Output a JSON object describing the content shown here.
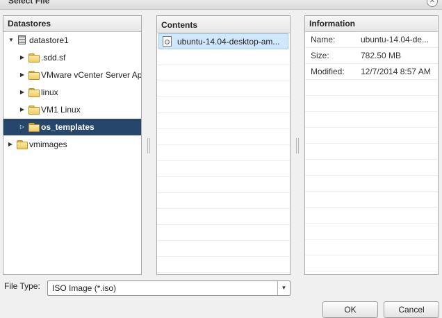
{
  "dialog": {
    "title": "Select File",
    "close_glyph": "✕"
  },
  "datastores": {
    "header": "Datastores",
    "items": [
      {
        "label": "datastore1",
        "expanded": true
      },
      {
        "label": ".sdd.sf"
      },
      {
        "label": "VMware vCenter Server Ap"
      },
      {
        "label": "linux"
      },
      {
        "label": "VM1 Linux"
      },
      {
        "label": "os_templates",
        "selected": true
      },
      {
        "label": "vmimages"
      }
    ]
  },
  "contents": {
    "header": "Contents",
    "items": [
      {
        "label": "ubuntu-14.04-desktop-am...",
        "icon": "iso-file-icon",
        "selected": true
      }
    ]
  },
  "information": {
    "header": "Information",
    "rows": [
      {
        "key": "Name:",
        "value": "ubuntu-14.04-de..."
      },
      {
        "key": "Size:",
        "value": "782.50 MB"
      },
      {
        "key": "Modified:",
        "value": "12/7/2014 8:57 AM"
      }
    ]
  },
  "file_type": {
    "label": "File Type:",
    "value": "ISO Image (*.iso)"
  },
  "buttons": {
    "ok": "OK",
    "cancel": "Cancel"
  },
  "colors": {
    "selection": "#26476b",
    "content_selection": "#cfe8fb"
  }
}
